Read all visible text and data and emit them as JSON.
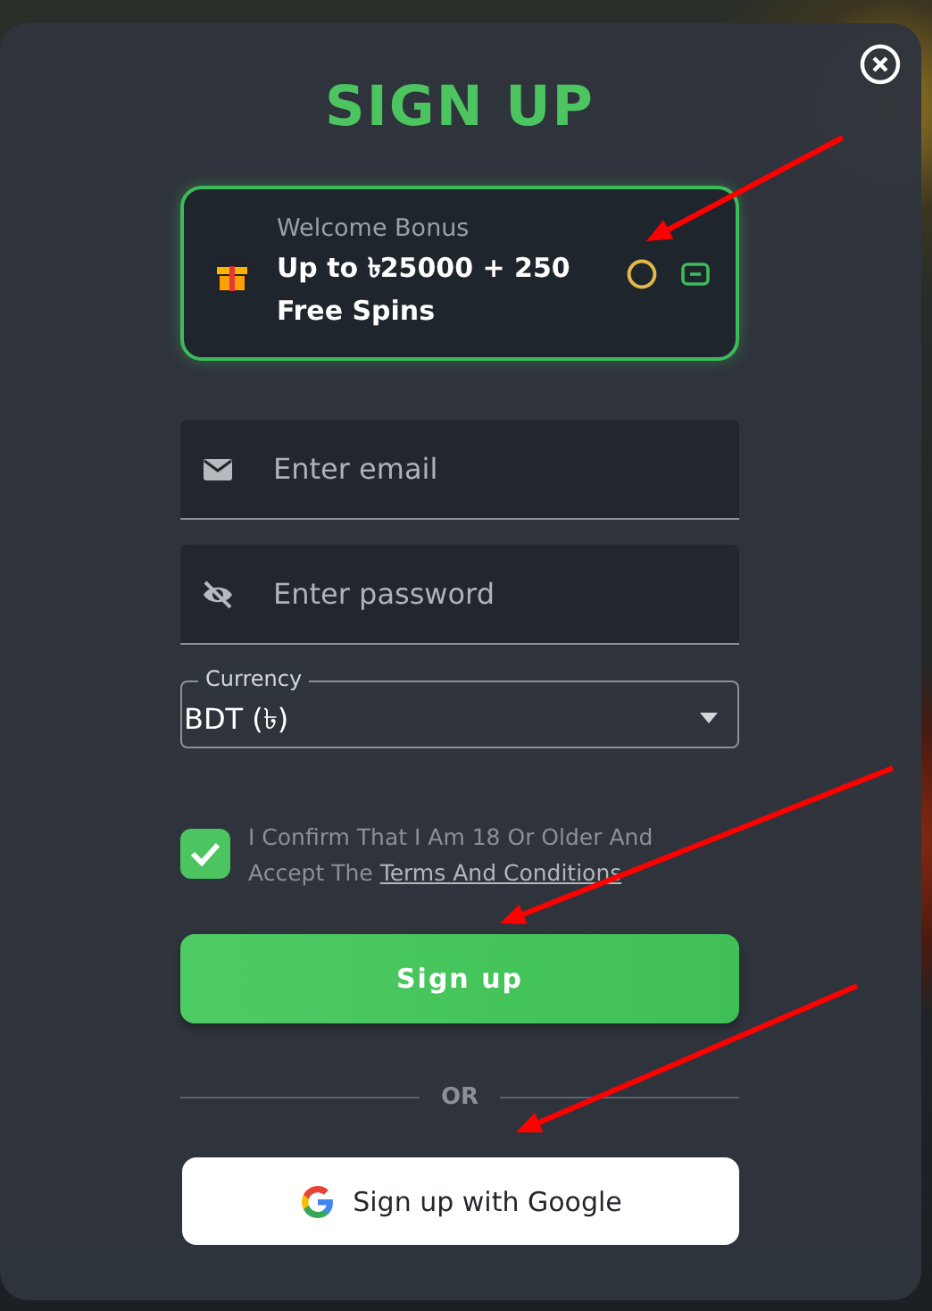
{
  "dialog": {
    "title": "SIGN UP"
  },
  "bonus": {
    "label": "Welcome Bonus",
    "text": "Up to ৳25000 + 250 Free Spins"
  },
  "fields": [
    {
      "kind": "email",
      "placeholder": "Enter email"
    },
    {
      "kind": "password",
      "placeholder": "Enter password"
    }
  ],
  "currency": {
    "label": "Currency",
    "value": "BDT (৳)"
  },
  "consent": {
    "checked": true,
    "text": "I Confirm That I Am 18 Or Older And Accept The ",
    "link": "Terms And Conditions"
  },
  "submit": "Sign up",
  "divider": "OR",
  "google_button": "Sign up with Google"
}
